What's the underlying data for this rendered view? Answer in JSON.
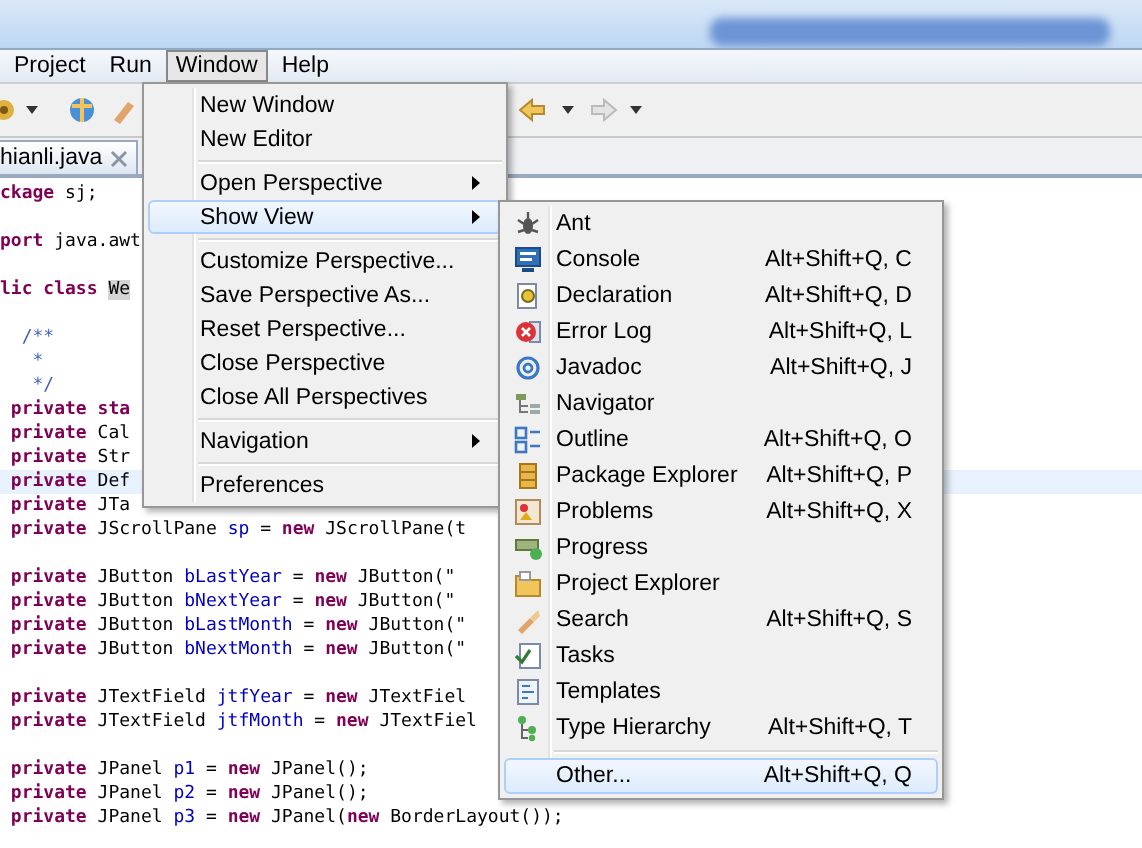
{
  "menubar": {
    "items": [
      {
        "label": "Project",
        "selected": false
      },
      {
        "label": "Run",
        "selected": false
      },
      {
        "label": "Window",
        "selected": true
      },
      {
        "label": "Help",
        "selected": false
      }
    ]
  },
  "editor": {
    "tab": {
      "label": "hianli.java"
    },
    "lines": [
      {
        "kind": "code",
        "current": false,
        "tokens": [
          {
            "t": "ckage",
            "kind": "kw"
          },
          {
            "t": " sj;",
            "kind": "plain"
          }
        ]
      },
      {
        "kind": "blank"
      },
      {
        "kind": "code",
        "current": false,
        "tokens": [
          {
            "t": "port",
            "kind": "kw"
          },
          {
            "t": " java.awt",
            "kind": "plain"
          }
        ]
      },
      {
        "kind": "blank"
      },
      {
        "kind": "code",
        "current": false,
        "tokens": [
          {
            "t": "lic class ",
            "kind": "kw"
          },
          {
            "t": "We",
            "kind": "mark"
          }
        ]
      },
      {
        "kind": "blank"
      },
      {
        "kind": "code",
        "current": false,
        "tokens": [
          {
            "t": "  /**",
            "kind": "comment"
          }
        ]
      },
      {
        "kind": "code",
        "current": false,
        "tokens": [
          {
            "t": "   *",
            "kind": "comment"
          }
        ]
      },
      {
        "kind": "code",
        "current": false,
        "tokens": [
          {
            "t": "   */",
            "kind": "comment"
          }
        ]
      },
      {
        "kind": "code",
        "current": false,
        "tokens": [
          {
            "t": " private",
            "kind": "kw"
          },
          {
            "t": " sta",
            "kind": "kw"
          }
        ]
      },
      {
        "kind": "code",
        "current": false,
        "tokens": [
          {
            "t": " private",
            "kind": "kw"
          },
          {
            "t": " Cal",
            "kind": "plain"
          }
        ]
      },
      {
        "kind": "code",
        "current": false,
        "tokens": [
          {
            "t": " private",
            "kind": "kw"
          },
          {
            "t": " Str",
            "kind": "plain"
          }
        ]
      },
      {
        "kind": "code",
        "current": true,
        "tokens": [
          {
            "t": " private",
            "kind": "kw"
          },
          {
            "t": " Def",
            "kind": "plain"
          }
        ]
      },
      {
        "kind": "code",
        "current": false,
        "tokens": [
          {
            "t": " private",
            "kind": "kw"
          },
          {
            "t": " JTa",
            "kind": "plain"
          }
        ]
      },
      {
        "kind": "code",
        "current": false,
        "tokens": [
          {
            "t": " private",
            "kind": "kw"
          },
          {
            "t": " JScrollPane ",
            "kind": "plain"
          },
          {
            "t": "sp",
            "kind": "field"
          },
          {
            "t": " = ",
            "kind": "plain"
          },
          {
            "t": "new",
            "kind": "kw"
          },
          {
            "t": " JScrollPane(t",
            "kind": "plain"
          }
        ]
      },
      {
        "kind": "blank"
      },
      {
        "kind": "code",
        "current": false,
        "tokens": [
          {
            "t": " private",
            "kind": "kw"
          },
          {
            "t": " JButton ",
            "kind": "plain"
          },
          {
            "t": "bLastYear",
            "kind": "field"
          },
          {
            "t": " = ",
            "kind": "plain"
          },
          {
            "t": "new",
            "kind": "kw"
          },
          {
            "t": " JButton(\"",
            "kind": "plain"
          }
        ]
      },
      {
        "kind": "code",
        "current": false,
        "tokens": [
          {
            "t": " private",
            "kind": "kw"
          },
          {
            "t": " JButton ",
            "kind": "plain"
          },
          {
            "t": "bNextYear",
            "kind": "field"
          },
          {
            "t": " = ",
            "kind": "plain"
          },
          {
            "t": "new",
            "kind": "kw"
          },
          {
            "t": " JButton(\"",
            "kind": "plain"
          }
        ]
      },
      {
        "kind": "code",
        "current": false,
        "tokens": [
          {
            "t": " private",
            "kind": "kw"
          },
          {
            "t": " JButton ",
            "kind": "plain"
          },
          {
            "t": "bLastMonth",
            "kind": "field"
          },
          {
            "t": " = ",
            "kind": "plain"
          },
          {
            "t": "new",
            "kind": "kw"
          },
          {
            "t": " JButton(\"",
            "kind": "plain"
          }
        ]
      },
      {
        "kind": "code",
        "current": false,
        "tokens": [
          {
            "t": " private",
            "kind": "kw"
          },
          {
            "t": " JButton ",
            "kind": "plain"
          },
          {
            "t": "bNextMonth",
            "kind": "field"
          },
          {
            "t": " = ",
            "kind": "plain"
          },
          {
            "t": "new",
            "kind": "kw"
          },
          {
            "t": " JButton(\"",
            "kind": "plain"
          }
        ]
      },
      {
        "kind": "blank"
      },
      {
        "kind": "code",
        "current": false,
        "tokens": [
          {
            "t": " private",
            "kind": "kw"
          },
          {
            "t": " JTextField ",
            "kind": "plain"
          },
          {
            "t": "jtfYear",
            "kind": "field"
          },
          {
            "t": " = ",
            "kind": "plain"
          },
          {
            "t": "new",
            "kind": "kw"
          },
          {
            "t": " JTextFiel",
            "kind": "plain"
          }
        ]
      },
      {
        "kind": "code",
        "current": false,
        "tokens": [
          {
            "t": " private",
            "kind": "kw"
          },
          {
            "t": " JTextField ",
            "kind": "plain"
          },
          {
            "t": "jtfMonth",
            "kind": "field"
          },
          {
            "t": " = ",
            "kind": "plain"
          },
          {
            "t": "new",
            "kind": "kw"
          },
          {
            "t": " JTextFiel",
            "kind": "plain"
          }
        ]
      },
      {
        "kind": "blank"
      },
      {
        "kind": "code",
        "current": false,
        "tokens": [
          {
            "t": " private",
            "kind": "kw"
          },
          {
            "t": " JPanel ",
            "kind": "plain"
          },
          {
            "t": "p1",
            "kind": "field"
          },
          {
            "t": " = ",
            "kind": "plain"
          },
          {
            "t": "new",
            "kind": "kw"
          },
          {
            "t": " JPanel();",
            "kind": "plain"
          }
        ]
      },
      {
        "kind": "code",
        "current": false,
        "tokens": [
          {
            "t": " private",
            "kind": "kw"
          },
          {
            "t": " JPanel ",
            "kind": "plain"
          },
          {
            "t": "p2",
            "kind": "field"
          },
          {
            "t": " = ",
            "kind": "plain"
          },
          {
            "t": "new",
            "kind": "kw"
          },
          {
            "t": " JPanel();",
            "kind": "plain"
          }
        ]
      },
      {
        "kind": "code",
        "current": false,
        "tokens": [
          {
            "t": " private",
            "kind": "kw"
          },
          {
            "t": " JPanel ",
            "kind": "plain"
          },
          {
            "t": "p3",
            "kind": "field"
          },
          {
            "t": " = ",
            "kind": "plain"
          },
          {
            "t": "new",
            "kind": "kw"
          },
          {
            "t": " JPanel(",
            "kind": "plain"
          },
          {
            "t": "new",
            "kind": "kw"
          },
          {
            "t": " BorderLayout());",
            "kind": "plain"
          }
        ]
      }
    ]
  },
  "window_menu": {
    "items": [
      {
        "kind": "item",
        "label": "New Window",
        "submenu": false,
        "selected": false
      },
      {
        "kind": "item",
        "label": "New Editor",
        "submenu": false,
        "selected": false
      },
      {
        "kind": "separator"
      },
      {
        "kind": "item",
        "label": "Open Perspective",
        "submenu": true,
        "selected": false
      },
      {
        "kind": "item",
        "label": "Show View",
        "submenu": true,
        "selected": true
      },
      {
        "kind": "separator"
      },
      {
        "kind": "item",
        "label": "Customize Perspective...",
        "submenu": false,
        "selected": false
      },
      {
        "kind": "item",
        "label": "Save Perspective As...",
        "submenu": false,
        "selected": false
      },
      {
        "kind": "item",
        "label": "Reset Perspective...",
        "submenu": false,
        "selected": false
      },
      {
        "kind": "item",
        "label": "Close Perspective",
        "submenu": false,
        "selected": false
      },
      {
        "kind": "item",
        "label": "Close All Perspectives",
        "submenu": false,
        "selected": false
      },
      {
        "kind": "separator"
      },
      {
        "kind": "item",
        "label": "Navigation",
        "submenu": true,
        "selected": false
      },
      {
        "kind": "separator"
      },
      {
        "kind": "item",
        "label": "Preferences",
        "submenu": false,
        "selected": false
      }
    ]
  },
  "show_view_menu": {
    "items": [
      {
        "kind": "item",
        "label": "Ant",
        "selected": false
      },
      {
        "kind": "item",
        "label": "Console",
        "shortcut": "Alt+Shift+Q, C",
        "selected": false
      },
      {
        "kind": "item",
        "label": "Declaration",
        "shortcut": "Alt+Shift+Q, D",
        "selected": false
      },
      {
        "kind": "item",
        "label": "Error Log",
        "shortcut": "Alt+Shift+Q, L",
        "selected": false
      },
      {
        "kind": "item",
        "label": "Javadoc",
        "shortcut": "Alt+Shift+Q, J",
        "selected": false
      },
      {
        "kind": "item",
        "label": "Navigator",
        "selected": false
      },
      {
        "kind": "item",
        "label": "Outline",
        "shortcut": "Alt+Shift+Q, O",
        "selected": false
      },
      {
        "kind": "item",
        "label": "Package Explorer",
        "shortcut": "Alt+Shift+Q, P",
        "selected": false
      },
      {
        "kind": "item",
        "label": "Problems",
        "shortcut": "Alt+Shift+Q, X",
        "selected": false
      },
      {
        "kind": "item",
        "label": "Progress",
        "selected": false
      },
      {
        "kind": "item",
        "label": "Project Explorer",
        "selected": false
      },
      {
        "kind": "item",
        "label": "Search",
        "shortcut": "Alt+Shift+Q, S",
        "selected": false
      },
      {
        "kind": "item",
        "label": "Tasks",
        "selected": false
      },
      {
        "kind": "item",
        "label": "Templates",
        "selected": false
      },
      {
        "kind": "item",
        "label": "Type Hierarchy",
        "shortcut": "Alt+Shift+Q, T",
        "selected": false
      },
      {
        "kind": "separator"
      },
      {
        "kind": "item",
        "label": "Other...",
        "shortcut": "Alt+Shift+Q, Q",
        "selected": true
      }
    ]
  }
}
